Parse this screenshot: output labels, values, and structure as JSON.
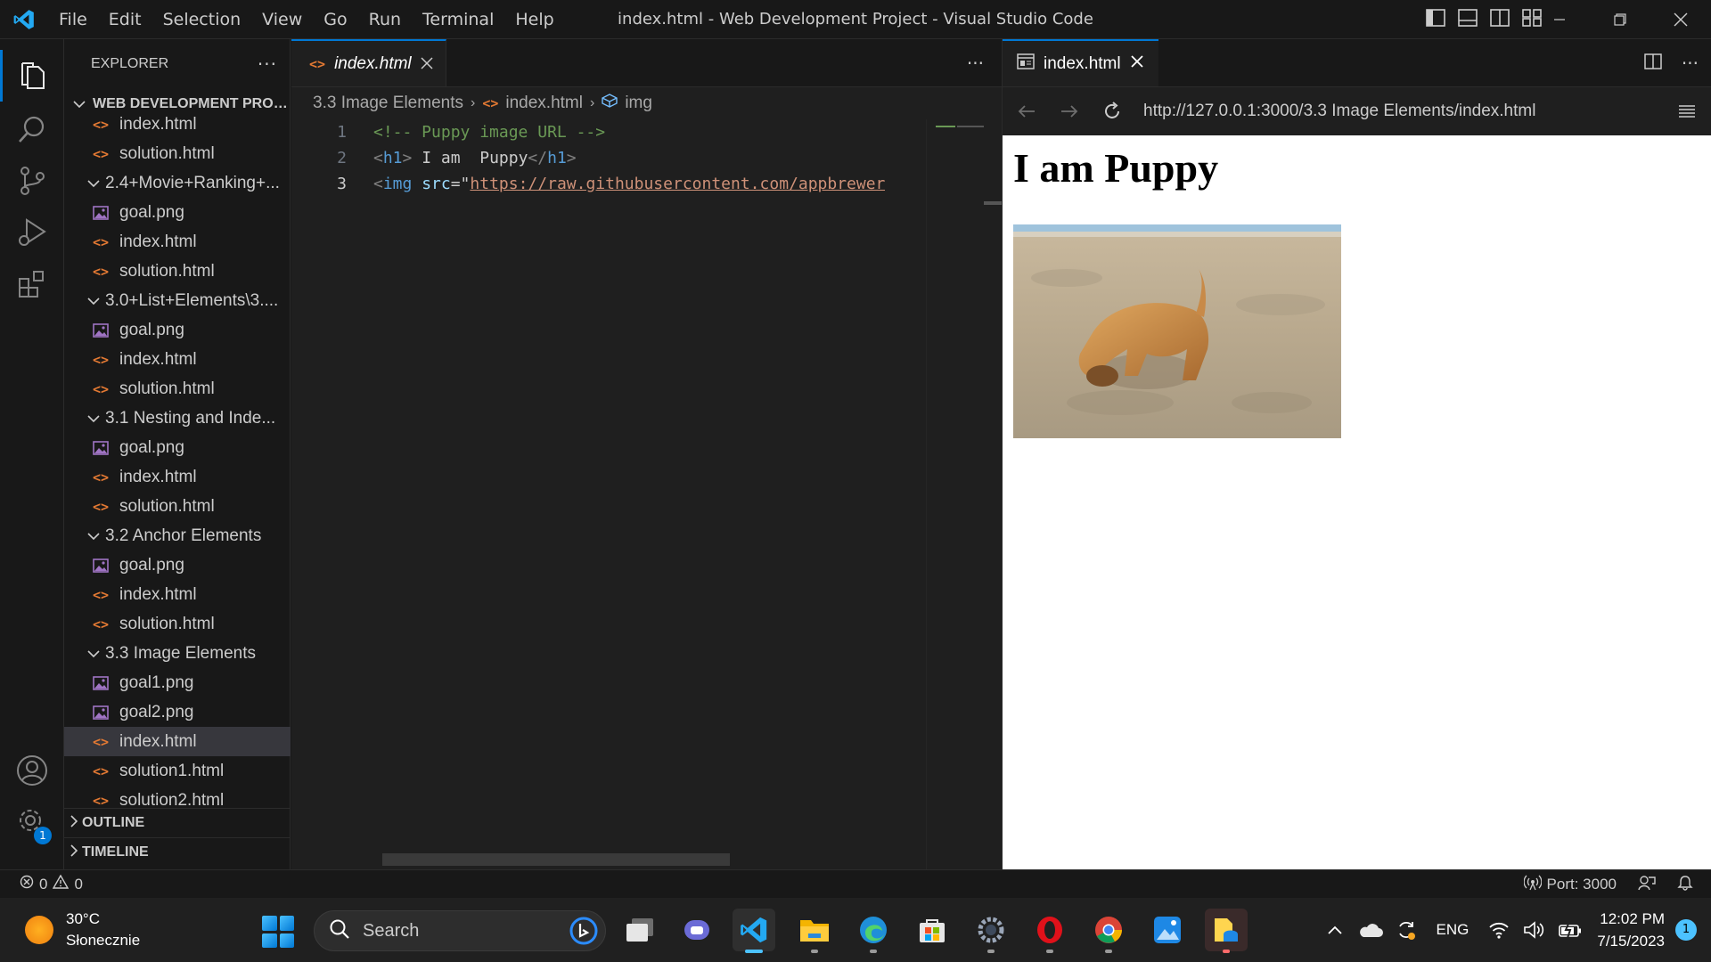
{
  "titlebar": {
    "menu": [
      "File",
      "Edit",
      "Selection",
      "View",
      "Go",
      "Run",
      "Terminal",
      "Help"
    ],
    "window_title": "index.html - Web Development Project - Visual Studio Code"
  },
  "activity_bar": {
    "settings_badge": "1"
  },
  "sidebar": {
    "title": "EXPLORER",
    "more": "···",
    "project": "WEB DEVELOPMENT PROJ...",
    "items": [
      {
        "label": "index.html",
        "type": "html",
        "depth": 1
      },
      {
        "label": "solution.html",
        "type": "html",
        "depth": 1
      },
      {
        "label": "2.4+Movie+Ranking+...",
        "type": "folder",
        "depth": 0
      },
      {
        "label": "goal.png",
        "type": "image",
        "depth": 1
      },
      {
        "label": "index.html",
        "type": "html",
        "depth": 1
      },
      {
        "label": "solution.html",
        "type": "html",
        "depth": 1
      },
      {
        "label": "3.0+List+Elements\\3....",
        "type": "folder",
        "depth": 0
      },
      {
        "label": "goal.png",
        "type": "image",
        "depth": 1
      },
      {
        "label": "index.html",
        "type": "html",
        "depth": 1
      },
      {
        "label": "solution.html",
        "type": "html",
        "depth": 1
      },
      {
        "label": "3.1 Nesting and Inde...",
        "type": "folder",
        "depth": 0
      },
      {
        "label": "goal.png",
        "type": "image",
        "depth": 1
      },
      {
        "label": "index.html",
        "type": "html",
        "depth": 1
      },
      {
        "label": "solution.html",
        "type": "html",
        "depth": 1
      },
      {
        "label": "3.2 Anchor Elements",
        "type": "folder",
        "depth": 0
      },
      {
        "label": "goal.png",
        "type": "image",
        "depth": 1
      },
      {
        "label": "index.html",
        "type": "html",
        "depth": 1
      },
      {
        "label": "solution.html",
        "type": "html",
        "depth": 1
      },
      {
        "label": "3.3 Image Elements",
        "type": "folder",
        "depth": 0
      },
      {
        "label": "goal1.png",
        "type": "image",
        "depth": 1
      },
      {
        "label": "goal2.png",
        "type": "image",
        "depth": 1
      },
      {
        "label": "index.html",
        "type": "html",
        "depth": 1,
        "selected": true
      },
      {
        "label": "solution1.html",
        "type": "html",
        "depth": 1
      },
      {
        "label": "solution2.html",
        "type": "html",
        "depth": 1
      }
    ],
    "outline": "OUTLINE",
    "timeline": "TIMELINE"
  },
  "editor": {
    "tab_label": "index.html",
    "more": "···",
    "breadcrumb": [
      "3.3 Image Elements",
      "index.html",
      "img"
    ],
    "lines": [
      {
        "num": "1",
        "comment": "<!-- Puppy image URL -->"
      },
      {
        "num": "2",
        "open": "<",
        "tag": "h1",
        "close": ">",
        "text": " I am  Puppy",
        "end_open": "</",
        "end_tag": "h1",
        "end_close": ">"
      },
      {
        "num": "3",
        "open": "<",
        "tag": "img",
        "attr": " src",
        "eq": "=\"",
        "str": "https://raw.githubusercontent.com/appbrewer"
      }
    ]
  },
  "preview": {
    "tab_label": "index.html",
    "more": "···",
    "url": "http://127.0.0.1:3000/3.3 Image Elements/index.html",
    "heading": "I am Puppy"
  },
  "statusbar": {
    "errors": "0",
    "warnings": "0",
    "port": "Port: 3000"
  },
  "taskbar": {
    "temperature": "30°C",
    "weather": "Słonecznie",
    "search": "Search",
    "language": "ENG",
    "time": "12:02 PM",
    "date": "7/15/2023",
    "notifications": "1"
  },
  "colors": {
    "accent": "#0078d4",
    "html_icon": "#e37933",
    "image_icon": "#a074c4",
    "comment": "#6a9955",
    "tag": "#569cd6",
    "attr": "#9cdcfe",
    "string": "#ce9178"
  }
}
